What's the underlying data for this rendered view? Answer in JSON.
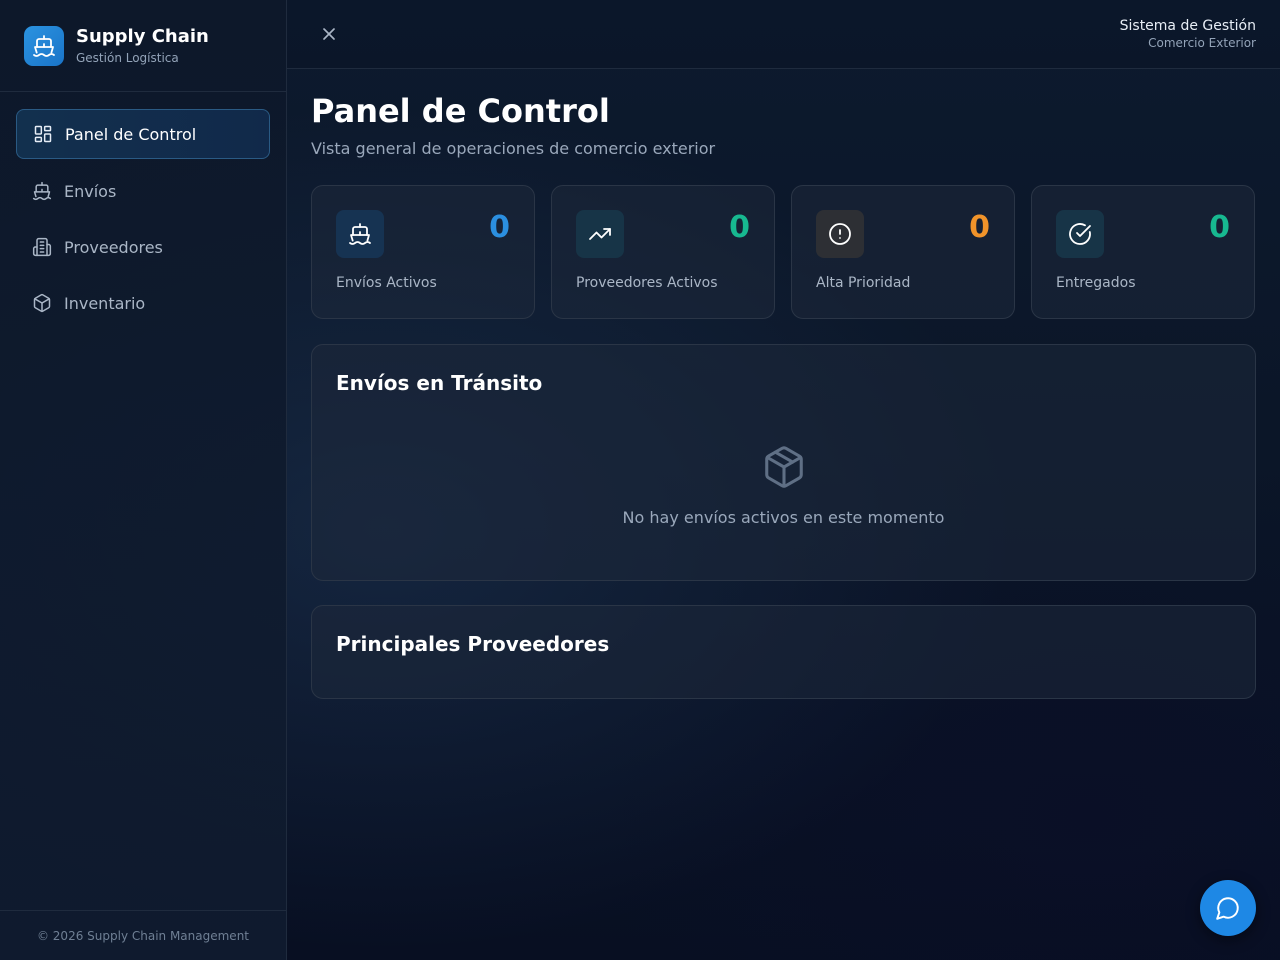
{
  "brand": {
    "title": "Supply Chain",
    "subtitle": "Gestión Logística"
  },
  "sidebar": {
    "items": [
      {
        "label": "Panel de Control",
        "icon": "dashboard-icon",
        "active": true
      },
      {
        "label": "Envíos",
        "icon": "ship-icon",
        "active": false
      },
      {
        "label": "Proveedores",
        "icon": "building-icon",
        "active": false
      },
      {
        "label": "Inventario",
        "icon": "package-icon",
        "active": false
      }
    ],
    "footer": "© 2026 Supply Chain Management"
  },
  "topbar": {
    "system_title": "Sistema de Gestión",
    "system_subtitle": "Comercio Exterior"
  },
  "page": {
    "title": "Panel de Control",
    "subtitle": "Vista general de operaciones de comercio exterior"
  },
  "stats": [
    {
      "label": "Envíos Activos",
      "value": "0",
      "icon": "ship-icon",
      "color": "#2b8fe0"
    },
    {
      "label": "Proveedores Activos",
      "value": "0",
      "icon": "trending-up-icon",
      "color": "#17b890"
    },
    {
      "label": "Alta Prioridad",
      "value": "0",
      "icon": "alert-circle-icon",
      "color": "#f0932a"
    },
    {
      "label": "Entregados",
      "value": "0",
      "icon": "check-circle-icon",
      "color": "#17b890"
    }
  ],
  "transit": {
    "title": "Envíos en Tránsito",
    "empty_text": "No hay envíos activos en este momento"
  },
  "providers": {
    "title": "Principales Proveedores"
  },
  "colors": {
    "accent": "#1e88e5",
    "background": "#0b1628"
  }
}
